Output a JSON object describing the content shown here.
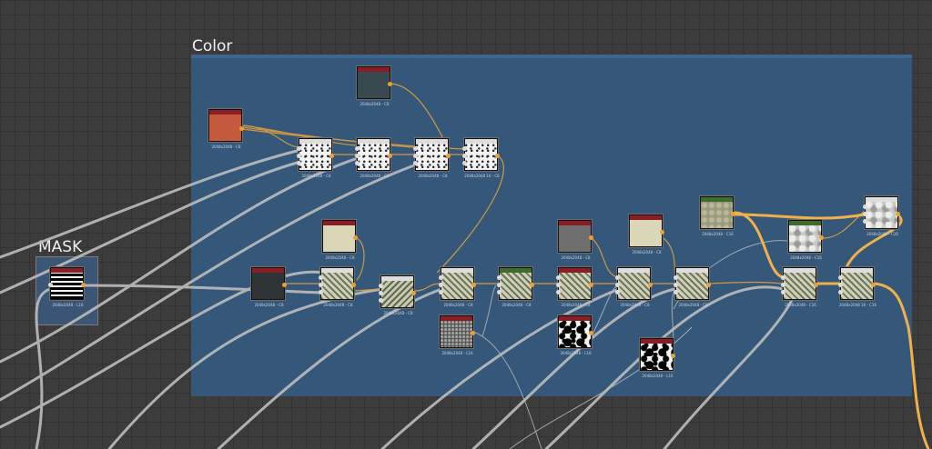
{
  "frames": {
    "color": {
      "title": "Color",
      "fill": "#35587a"
    },
    "mask": {
      "title": "MASK",
      "fill": "#3b5675"
    }
  },
  "colors": {
    "canvas": "#3c3c3c",
    "wire_default": "#bdbdbd",
    "wire_selected": "#e9a238",
    "header_default": "#8a1e24",
    "header_green": "#3f6b2d"
  },
  "nodes": {
    "uniform_red": {
      "label": "2048x2048 - C8",
      "color": "#c65a3e"
    },
    "uniform_slate": {
      "label": "2048x2048 - C8",
      "color": "#384a50"
    },
    "blend_1": {
      "label": "2048x2048 - C8"
    },
    "blend_2": {
      "label": "2048x2048 - C8"
    },
    "blend_3": {
      "label": "2048x2048 - C8"
    },
    "blend_4": {
      "label": "2048x2048 16 - C8"
    },
    "uniform_cream_1": {
      "label": "2048x2048 - C8",
      "color": "#dcd6b8"
    },
    "uniform_dark": {
      "label": "2048x2048 - C8",
      "color": "#2f3436"
    },
    "blend_5": {
      "label": "2048x2048 - C8"
    },
    "blend_6": {
      "label": "2048x2048 - C8"
    },
    "blend_7": {
      "label": "2048x2048 - C8"
    },
    "blend_8": {
      "label": "2048x2048 - C8"
    },
    "grain_l16": {
      "label": "2048x2048 - L16"
    },
    "uniform_gray": {
      "label": "2048x2048 - C8",
      "color": "#6e6e6e"
    },
    "blend_9": {
      "label": "2048x2048 - C8"
    },
    "bw_1": {
      "label": "2048x2048 - L16"
    },
    "uniform_cream_2": {
      "label": "2048x2048 - C8",
      "color": "#dcd6b8"
    },
    "blend_10": {
      "label": "2048x2048 - C8"
    },
    "blend_11": {
      "label": "2048x2048 - C8"
    },
    "bw_2": {
      "label": "2048x2048 - L16"
    },
    "moss": {
      "label": "2048x2048 - C16"
    },
    "rock": {
      "label": "2048x2048 - C16"
    },
    "blend_12": {
      "label": "2048x2048 - C16"
    },
    "blend_13": {
      "label": "2048x2048 16 - C16"
    },
    "output_top": {
      "label": "2048x2048 - C16"
    },
    "mask_node": {
      "label": "2048x2048 - L16"
    }
  }
}
